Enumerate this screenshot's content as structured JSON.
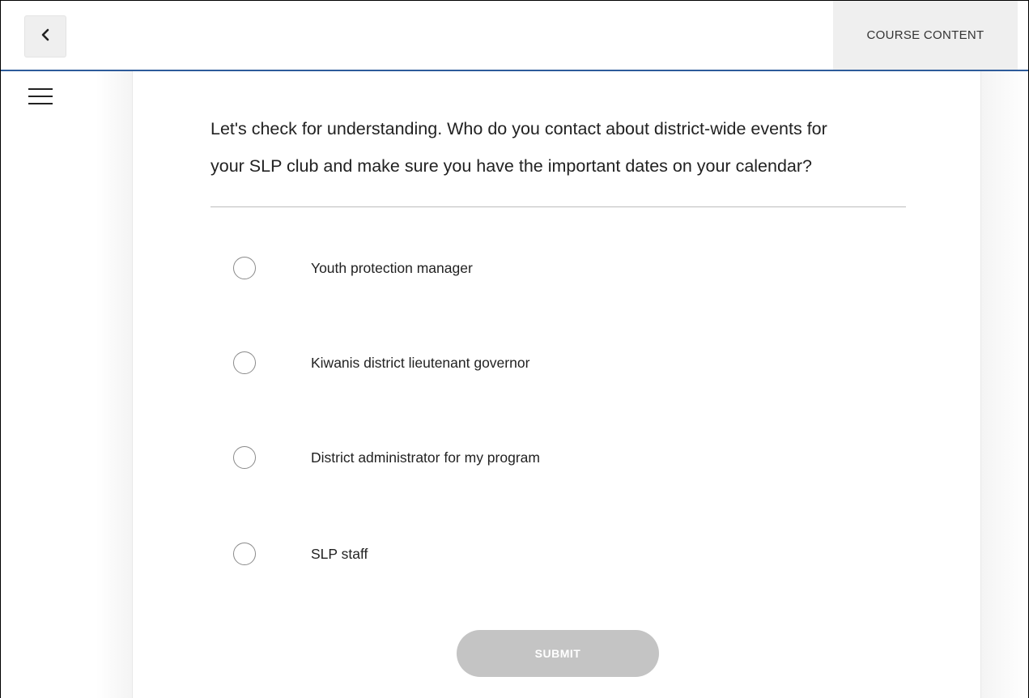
{
  "header": {
    "back_icon": "chevron-left-icon",
    "course_content_label": "COURSE CONTENT"
  },
  "sidebar": {
    "menu_icon": "hamburger-menu-icon"
  },
  "quiz": {
    "question_line1": "Let's check for understanding. Who do you contact about district-wide events for",
    "question_line2": "your SLP club and make sure you have the important dates on your calendar?",
    "options": [
      {
        "label": "Youth protection manager",
        "selected": false
      },
      {
        "label": "Kiwanis district lieutenant governor",
        "selected": false
      },
      {
        "label": "District administrator for my program",
        "selected": false
      },
      {
        "label": "SLP staff",
        "selected": false
      }
    ],
    "submit_label": "SUBMIT",
    "submit_enabled": false
  },
  "colors": {
    "header_border": "#2d5b9a",
    "submit_disabled": "#c4c4c4",
    "button_bg": "#efefef"
  }
}
